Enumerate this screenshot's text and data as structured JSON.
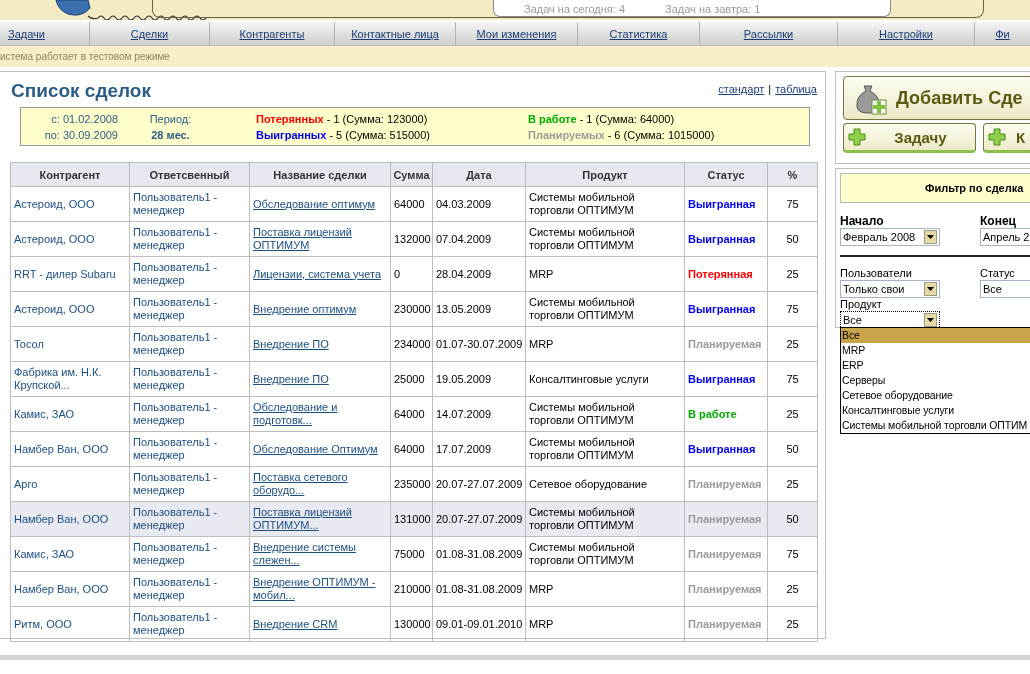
{
  "header": {
    "tasks_today": "Задач на сегодня: 4",
    "tasks_tomorrow": "Задач на завтра: 1"
  },
  "nav": [
    {
      "label": "Задачи"
    },
    {
      "label": "Сделки"
    },
    {
      "label": "Контрагенты"
    },
    {
      "label": "Контактные лица"
    },
    {
      "label": "Мои изменения"
    },
    {
      "label": "Статистика"
    },
    {
      "label": "Рассылки"
    },
    {
      "label": "Настройки"
    },
    {
      "label": "Фи"
    }
  ],
  "notice": "истема работает в тестовом режиме",
  "deals": {
    "title": "Список сделок",
    "view_links": [
      "стандарт",
      "таблица"
    ],
    "view_separator": "|",
    "summary": {
      "from": "с: 01.02.2008",
      "to": "по: 30.09.2009",
      "period_label": "Период:",
      "period_value": "28 мес.",
      "stats": [
        {
          "kind": "lost",
          "label": "Потерянных",
          "text": " - 1 (Сумма: 123000)"
        },
        {
          "kind": "in_progress",
          "label": "В работе",
          "text": " - 1 (Сумма: 64000)"
        },
        {
          "kind": "won",
          "label": "Выигранных",
          "text": " - 5 (Сумма: 515000)"
        },
        {
          "kind": "planned",
          "label": "Планируемых",
          "text": " - 6 (Сумма: 1015000)"
        }
      ]
    },
    "table": {
      "columns": [
        "Контрагент",
        "Ответсвенный",
        "Название сделки",
        "Сумма",
        "Дата",
        "Продукт",
        "Статус",
        "%"
      ],
      "rows": [
        {
          "counterparty": "Астероид, ООО",
          "owner": "Пользователь1 - менеджер",
          "deal": "Обследование оптимум",
          "sum": "64000",
          "date": "04.03.2009",
          "product": "Системы мобильной торговли ОПТИМУМ",
          "status": {
            "kind": "won",
            "label": "Выигранная"
          },
          "percent": "75",
          "selected": false
        },
        {
          "counterparty": "Астероид, ООО",
          "owner": "Пользователь1 - менеджер",
          "deal": "Поставка лицензий ОПТИМУМ",
          "sum": "132000",
          "date": "07.04.2009",
          "product": "Системы мобильной торговли ОПТИМУМ",
          "status": {
            "kind": "won",
            "label": "Выигранная"
          },
          "percent": "50",
          "selected": false
        },
        {
          "counterparty": "RRT - дилер Subaru",
          "owner": "Пользователь1 - менеджер",
          "deal": "Лицензии, система учета",
          "sum": "0",
          "date": "28.04.2009",
          "product": "MRP",
          "status": {
            "kind": "lost",
            "label": "Потерянная"
          },
          "percent": "25",
          "selected": false
        },
        {
          "counterparty": "Астероид, ООО",
          "owner": "Пользователь1 - менеджер",
          "deal": "Внедрение оптимум",
          "sum": "230000",
          "date": "13.05.2009",
          "product": "Системы мобильной торговли ОПТИМУМ",
          "status": {
            "kind": "won",
            "label": "Выигранная"
          },
          "percent": "75",
          "selected": false
        },
        {
          "counterparty": "Тосол",
          "owner": "Пользователь1 - менеджер",
          "deal": "Внедрение ПО",
          "sum": "234000",
          "date": "01.07-30.07.2009",
          "product": "MRP",
          "status": {
            "kind": "planned",
            "label": "Планируемая"
          },
          "percent": "25",
          "selected": false
        },
        {
          "counterparty": "Фабрика им. Н.К. Крупской...",
          "owner": "Пользователь1 - менеджер",
          "deal": "Внедрение ПО",
          "sum": "25000",
          "date": "19.05.2009",
          "product": "Консалтинговые услуги",
          "status": {
            "kind": "won",
            "label": "Выигранная"
          },
          "percent": "75",
          "selected": false
        },
        {
          "counterparty": "Камис, ЗАО",
          "owner": "Пользователь1 - менеджер",
          "deal": "Обследование и подготовк...",
          "sum": "64000",
          "date": "14.07.2009",
          "product": "Системы мобильной торговли ОПТИМУМ",
          "status": {
            "kind": "in_progress",
            "label": "В работе"
          },
          "percent": "25",
          "selected": false
        },
        {
          "counterparty": "Намбер Ван, ООО",
          "owner": "Пользователь1 - менеджер",
          "deal": "Обследование Оптимум",
          "sum": "64000",
          "date": "17.07.2009",
          "product": "Системы мобильной торговли ОПТИМУМ",
          "status": {
            "kind": "won",
            "label": "Выигранная"
          },
          "percent": "50",
          "selected": false
        },
        {
          "counterparty": "Арго",
          "owner": "Пользователь1 - менеджер",
          "deal": "Поставка сетевого оборудо...",
          "sum": "235000",
          "date": "20.07-27.07.2009",
          "product": "Сетевое оборудование",
          "status": {
            "kind": "planned",
            "label": "Планируемая"
          },
          "percent": "25",
          "selected": false
        },
        {
          "counterparty": "Намбер Ван, ООО",
          "owner": "Пользователь1 - менеджер",
          "deal": "Поставка лицензий ОПТИМУМ...",
          "sum": "131000",
          "date": "20.07-27.07.2009",
          "product": "Системы мобильной торговли ОПТИМУМ",
          "status": {
            "kind": "planned",
            "label": "Планируемая"
          },
          "percent": "50",
          "selected": true
        },
        {
          "counterparty": "Камис, ЗАО",
          "owner": "Пользователь1 - менеджер",
          "deal": "Внедрение системы слежен...",
          "sum": "75000",
          "date": "01.08-31.08.2009",
          "product": "Системы мобильной торговли ОПТИМУМ",
          "status": {
            "kind": "planned",
            "label": "Планируемая"
          },
          "percent": "75",
          "selected": false
        },
        {
          "counterparty": "Намбер Ван, ООО",
          "owner": "Пользователь1 - менеджер",
          "deal": "Внедрение ОПТИМУМ - мобил...",
          "sum": "210000",
          "date": "01.08-31.08.2009",
          "product": "MRP",
          "status": {
            "kind": "planned",
            "label": "Планируемая"
          },
          "percent": "25",
          "selected": false
        },
        {
          "counterparty": "Ритм, ООО",
          "owner": "Пользователь1 - менеджер",
          "deal": "Внедрение CRM",
          "sum": "130000",
          "date": "09.01-09.01.2010",
          "product": "MRP",
          "status": {
            "kind": "planned",
            "label": "Планируемая"
          },
          "percent": "25",
          "selected": false
        }
      ]
    }
  },
  "sidebar": {
    "add_deal_button": "Добавить Сде",
    "quick_buttons": [
      "Задачу",
      "К"
    ],
    "filter": {
      "title": "Фильтр по сделка",
      "period": [
        {
          "label": "Начало",
          "value": "Февраль 2008"
        },
        {
          "label": "Конец",
          "value": "Апрель 2"
        }
      ],
      "users": {
        "label": "Пользователи",
        "value": "Только свои"
      },
      "status": {
        "label": "Статус",
        "value": "Все"
      },
      "product": {
        "label": "Продукт",
        "value": "Все",
        "expanded": true,
        "options": [
          {
            "label": "Все",
            "selected": true
          },
          {
            "label": "MRP",
            "selected": false
          },
          {
            "label": "ERP",
            "selected": false
          },
          {
            "label": "Серверы",
            "selected": false
          },
          {
            "label": "Сетевое оборудование",
            "selected": false
          },
          {
            "label": "Консалтинговые услуги",
            "selected": false
          },
          {
            "label": "Системы мобильной торговли ОПТИМ",
            "selected": false
          }
        ]
      }
    }
  }
}
